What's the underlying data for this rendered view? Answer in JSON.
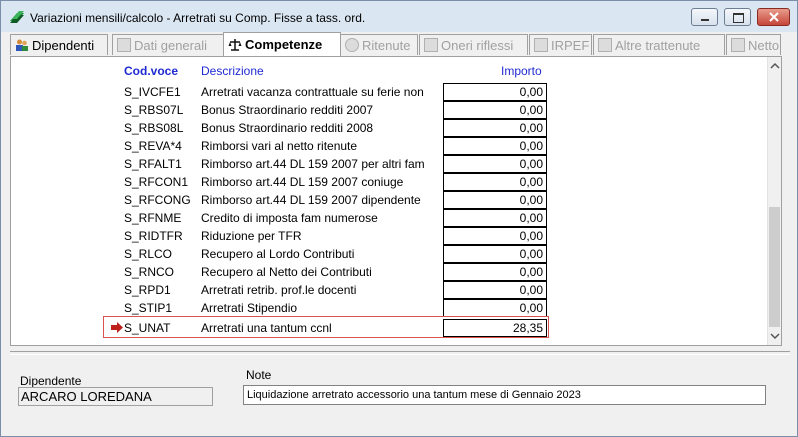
{
  "window": {
    "title": "Variazioni mensili/calcolo - Arretrati su Comp. Fisse a tass. ord."
  },
  "tabs": [
    {
      "label": "Dipendenti",
      "icon": "people-icon",
      "state": "enabled"
    },
    {
      "label": "Dati generali",
      "icon": "form-icon",
      "state": "disabled"
    },
    {
      "label": "Competenze",
      "icon": "balance-icon",
      "state": "active"
    },
    {
      "label": "Ritenute",
      "icon": "cog-icon",
      "state": "disabled"
    },
    {
      "label": "Oneri riflessi",
      "icon": "form-icon",
      "state": "disabled"
    },
    {
      "label": "IRPEF",
      "icon": "form-icon",
      "state": "disabled"
    },
    {
      "label": "Altre trattenute",
      "icon": "form-icon",
      "state": "disabled"
    },
    {
      "label": "Netto",
      "icon": "form-icon",
      "state": "disabled"
    }
  ],
  "table": {
    "headers": {
      "code": "Cod.voce",
      "desc": "Descrizione",
      "amount": "Importo"
    },
    "rows": [
      {
        "code": "S_IVCFE1",
        "desc": "Arretrati vacanza contrattuale su ferie non",
        "amount": "0,00"
      },
      {
        "code": "S_RBS07L",
        "desc": "Bonus Straordinario redditi 2007",
        "amount": "0,00"
      },
      {
        "code": "S_RBS08L",
        "desc": "Bonus Straordinario redditi 2008",
        "amount": "0,00"
      },
      {
        "code": "S_REVA*4",
        "desc": "Rimborsi vari al netto ritenute",
        "amount": "0,00"
      },
      {
        "code": "S_RFALT1",
        "desc": "Rimborso art.44 DL 159 2007 per altri fam",
        "amount": "0,00"
      },
      {
        "code": "S_RFCON1",
        "desc": "Rimborso art.44 DL 159 2007 coniuge",
        "amount": "0,00"
      },
      {
        "code": "S_RFCONG",
        "desc": "Rimborso art.44 DL 159 2007 dipendente",
        "amount": "0,00"
      },
      {
        "code": "S_RFNME",
        "desc": "Credito di imposta fam numerose",
        "amount": "0,00"
      },
      {
        "code": "S_RIDTFR",
        "desc": "Riduzione per TFR",
        "amount": "0,00"
      },
      {
        "code": "S_RLCO",
        "desc": "Recupero al Lordo Contributi",
        "amount": "0,00"
      },
      {
        "code": "S_RNCO",
        "desc": "Recupero al Netto dei Contributi",
        "amount": "0,00"
      },
      {
        "code": "S_RPD1",
        "desc": "Arretrati retrib. prof.le docenti",
        "amount": "0,00"
      },
      {
        "code": "S_STIP1",
        "desc": "Arretrati Stipendio",
        "amount": "0,00"
      },
      {
        "code": "S_UNAT",
        "desc": "Arretrati una tantum ccnl",
        "amount": "28,35",
        "selected": true
      }
    ]
  },
  "employee": {
    "label": "Dipendente",
    "value": "ARCARO LOREDANA"
  },
  "note": {
    "label": "Note",
    "value": "Liquidazione arretrato accessorio una tantum mese di Gennaio 2023"
  },
  "colors": {
    "header_text": "#1f2ad1",
    "selection_border": "#d9534f",
    "arrow": "#c0201c"
  }
}
